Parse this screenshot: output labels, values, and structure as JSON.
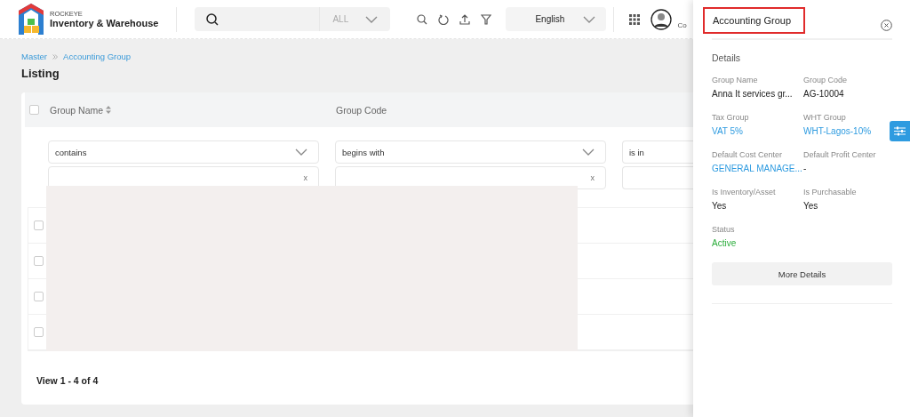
{
  "header": {
    "brand_small": "ROCKEYE",
    "brand": "Inventory & Warehouse",
    "search": {
      "scope": "ALL"
    },
    "language": "English",
    "user_label": "Co"
  },
  "breadcrumb": [
    "Master",
    "Accounting Group"
  ],
  "page_title": "Listing",
  "table": {
    "header_checked": false,
    "columns": [
      {
        "label": "Group Name",
        "sortable": true
      },
      {
        "label": "Group Code",
        "sortable": false
      }
    ],
    "filters": [
      {
        "operator": "contains",
        "clear": "x"
      },
      {
        "operator": "begins with",
        "clear": "x"
      },
      {
        "operator": "is in"
      }
    ],
    "rows": [
      {
        "checked": false
      },
      {
        "checked": false
      },
      {
        "checked": false
      },
      {
        "checked": false
      }
    ],
    "pager": "View 1 - 4 of 4"
  },
  "panel": {
    "title": "Accounting Group",
    "section": "Details",
    "fields": [
      {
        "label": "Group Name",
        "value": "Anna It services gr...",
        "kind": "text"
      },
      {
        "label": "Group Code",
        "value": "AG-10004",
        "kind": "text"
      },
      {
        "label": "Tax Group",
        "value": "VAT 5%",
        "kind": "link"
      },
      {
        "label": "WHT Group",
        "value": "WHT-Lagos-10%",
        "kind": "link"
      },
      {
        "label": "Default Cost Center",
        "value": "GENERAL MANAGE...",
        "kind": "link"
      },
      {
        "label": "Default Profit Center",
        "value": "-",
        "kind": "text"
      },
      {
        "label": "Is Inventory/Asset",
        "value": "Yes",
        "kind": "text"
      },
      {
        "label": "Is Purchasable",
        "value": "Yes",
        "kind": "text"
      },
      {
        "label": "Status",
        "value": "Active",
        "kind": "status"
      }
    ],
    "button": "More Details"
  }
}
